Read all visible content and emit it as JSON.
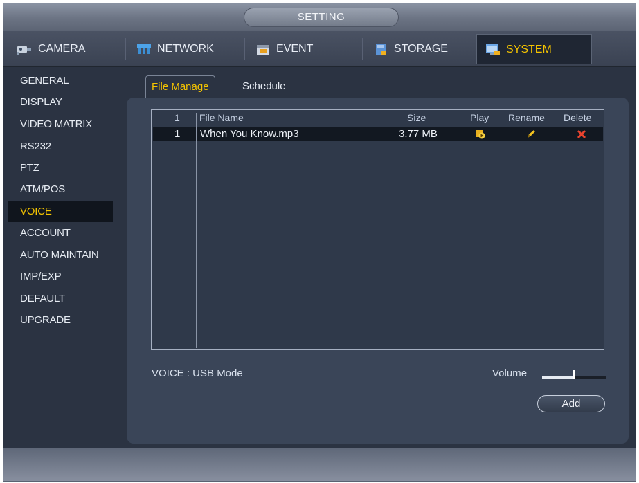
{
  "window": {
    "title": "SETTING"
  },
  "tabs": [
    {
      "label": "CAMERA",
      "icon": "camera-icon"
    },
    {
      "label": "NETWORK",
      "icon": "network-icon"
    },
    {
      "label": "EVENT",
      "icon": "event-icon"
    },
    {
      "label": "STORAGE",
      "icon": "storage-icon"
    },
    {
      "label": "SYSTEM",
      "icon": "system-icon",
      "active": true
    }
  ],
  "sidebar": {
    "items": [
      {
        "label": "GENERAL"
      },
      {
        "label": "DISPLAY"
      },
      {
        "label": "VIDEO MATRIX"
      },
      {
        "label": "RS232"
      },
      {
        "label": "PTZ"
      },
      {
        "label": "ATM/POS"
      },
      {
        "label": "VOICE",
        "active": true
      },
      {
        "label": "ACCOUNT"
      },
      {
        "label": "AUTO MAINTAIN"
      },
      {
        "label": "IMP/EXP"
      },
      {
        "label": "DEFAULT"
      },
      {
        "label": "UPGRADE"
      }
    ]
  },
  "content_tabs": [
    {
      "label": "File Manage",
      "active": true
    },
    {
      "label": "Schedule"
    }
  ],
  "table": {
    "headers": {
      "index": "1",
      "file_name": "File Name",
      "size": "Size",
      "play": "Play",
      "rename": "Rename",
      "delete": "Delete"
    },
    "rows": [
      {
        "index": "1",
        "file_name": "When You Know.mp3",
        "size": "3.77 MB",
        "play_icon": "play-icon",
        "rename_icon": "edit-icon",
        "delete_icon": "delete-icon"
      }
    ]
  },
  "footer": {
    "voice_mode": "VOICE : USB Mode",
    "volume_label": "Volume",
    "volume_level": 0.5,
    "add_label": "Add"
  },
  "colors": {
    "accent": "#f5c400",
    "background": "#2b3342",
    "panel": "#3a4558",
    "delete": "#e8432e"
  }
}
